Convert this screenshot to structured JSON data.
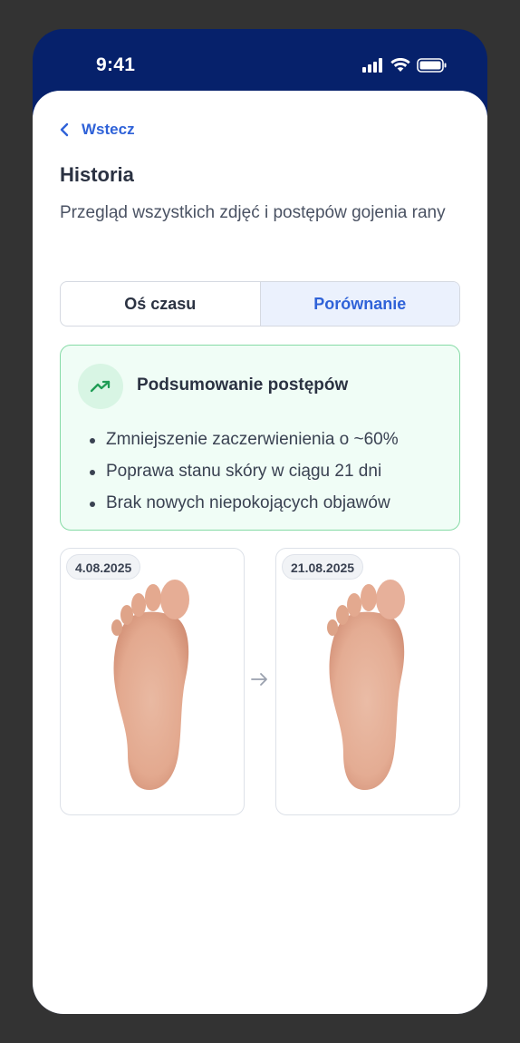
{
  "status": {
    "time": "9:41"
  },
  "nav": {
    "back_label": "Wstecz"
  },
  "page": {
    "title": "Historia",
    "subtitle": "Przegląd wszystkich zdjęć i postępów gojenia rany"
  },
  "tabs": [
    {
      "label": "Oś czasu",
      "active": false
    },
    {
      "label": "Porównanie",
      "active": true
    }
  ],
  "summary": {
    "title": "Podsumowanie postępów",
    "items": [
      "Zmniejszenie zaczerwienienia o ~60%",
      "Poprawa stanu skóry w ciągu 21 dni",
      "Brak nowych niepokojących objawów"
    ]
  },
  "comparison": {
    "before": {
      "date": "4.08.2025"
    },
    "after": {
      "date": "21.08.2025"
    }
  },
  "colors": {
    "accent": "#2f62d8",
    "header": "#06216b",
    "success": "#1f9d55"
  }
}
